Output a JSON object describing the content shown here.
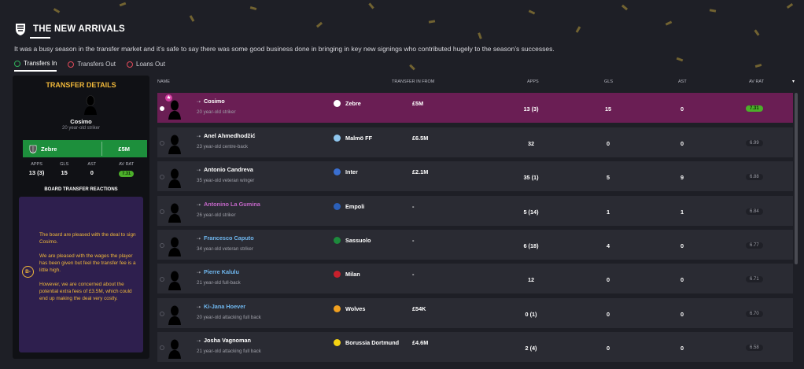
{
  "header": {
    "title": "THE NEW ARRIVALS",
    "intro": "It was a busy season in the transfer market and it’s safe to say there was some good business done in bringing in key new signings who contributed hugely to the season’s successes."
  },
  "tabs": [
    {
      "label": "Transfers In",
      "active": true
    },
    {
      "label": "Transfers Out",
      "active": false
    },
    {
      "label": "Loans Out",
      "active": false
    }
  ],
  "details": {
    "title": "TRANSFER DETAILS",
    "name": "Cosimo",
    "sub": "20 year-old striker",
    "club": "Zebre",
    "fee": "£5M",
    "stat_headers": [
      "APPS",
      "GLS",
      "AST",
      "AV RAT"
    ],
    "stats": [
      "13 (3)",
      "15",
      "0"
    ],
    "av_rat": "7.31",
    "board_title": "BOARD TRANSFER REACTIONS",
    "grade": "B-",
    "reactions": [
      "The board are pleased with the deal to sign Cosimo.",
      "We are pleased with the wages the player has been given but feel the transfer fee is a little high.",
      "However, we are concerned about the potential extra fees of £3.5M, which could end up making the deal very costly."
    ]
  },
  "table": {
    "headers": {
      "name": "NAME",
      "from": "TRANSFER IN FROM",
      "apps": "APPS",
      "gls": "GLS",
      "ast": "AST",
      "avrat": "AV RAT"
    },
    "rows": [
      {
        "name": "Cosimo",
        "desc": "20 year-old striker",
        "club": "Zebre",
        "fee": "£5M",
        "apps": "13 (3)",
        "gls": "15",
        "ast": "0",
        "rat": "7.31",
        "style": "normal",
        "club_color": "#ffffff"
      },
      {
        "name": "Anel Ahmedhodžić",
        "desc": "23 year-old centre-back",
        "club": "Malmö FF",
        "fee": "£6.5M",
        "apps": "32",
        "gls": "0",
        "ast": "0",
        "rat": "6.99",
        "style": "normal",
        "club_color": "#8fc6ee"
      },
      {
        "name": "Antonio Candreva",
        "desc": "35 year-old veteran winger",
        "club": "Inter",
        "fee": "£2.1M",
        "apps": "35 (1)",
        "gls": "5",
        "ast": "9",
        "rat": "6.88",
        "style": "normal",
        "club_color": "#3a6fd0"
      },
      {
        "name": "Antonino La Gumina",
        "desc": "26 year-old striker",
        "club": "Empoli",
        "fee": "-",
        "apps": "5 (14)",
        "gls": "1",
        "ast": "1",
        "rat": "6.84",
        "style": "loan",
        "club_color": "#2b5fb8"
      },
      {
        "name": "Francesco Caputo",
        "desc": "34 year-old veteran striker",
        "club": "Sassuolo",
        "fee": "-",
        "apps": "6 (18)",
        "gls": "4",
        "ast": "0",
        "rat": "6.77",
        "style": "blue",
        "club_color": "#1d8a3c"
      },
      {
        "name": "Pierre Kalulu",
        "desc": "21 year-old full-back",
        "club": "Milan",
        "fee": "-",
        "apps": "12",
        "gls": "0",
        "ast": "0",
        "rat": "6.71",
        "style": "blue",
        "club_color": "#c8202c"
      },
      {
        "name": "Ki-Jana Hoever",
        "desc": "20 year-old attacking full back",
        "club": "Wolves",
        "fee": "£54K",
        "apps": "0 (1)",
        "gls": "0",
        "ast": "0",
        "rat": "6.70",
        "style": "blue",
        "club_color": "#f0a020"
      },
      {
        "name": "Josha Vagnoman",
        "desc": "21 year-old attacking full back",
        "club": "Borussia Dortmund",
        "fee": "£4.6M",
        "apps": "2 (4)",
        "gls": "0",
        "ast": "0",
        "rat": "6.58",
        "style": "normal",
        "club_color": "#f5d312"
      }
    ]
  },
  "colors": {
    "accent_gold": "#f0b83a",
    "selected_row": "#6a1e54",
    "board_bg": "#2e1f4e",
    "club_green": "#1d8f3c"
  }
}
